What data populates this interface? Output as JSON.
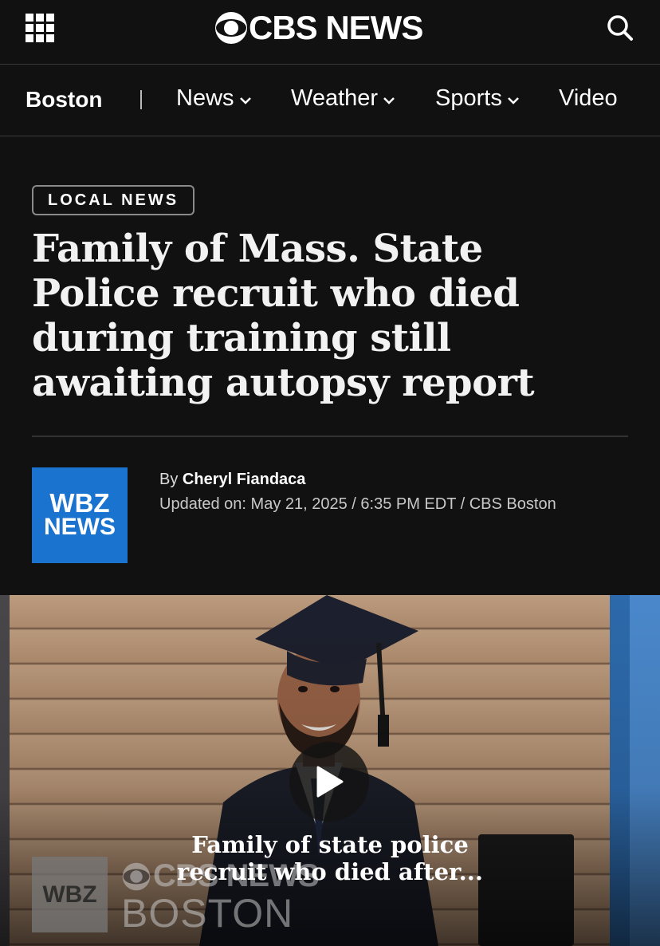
{
  "header": {
    "menu_icon": "grid-menu-icon",
    "logo_text": "CBS NEWS",
    "search_icon": "search-icon"
  },
  "nav": {
    "section": "Boston",
    "items": [
      {
        "label": "News",
        "has_dropdown": true
      },
      {
        "label": "Weather",
        "has_dropdown": true
      },
      {
        "label": "Sports",
        "has_dropdown": true
      },
      {
        "label": "Video",
        "has_dropdown": false
      }
    ]
  },
  "article": {
    "category": "LOCAL NEWS",
    "headline": "Family of Mass. State Police recruit who died during training still awaiting autopsy report",
    "byline_prefix": "By",
    "author": "Cheryl Fiandaca",
    "updated": "Updated on: May 21, 2025 / 6:35 PM EDT / CBS Boston",
    "source_logo": {
      "line1": "WBZ",
      "line2": "NEWS"
    }
  },
  "video": {
    "caption": "Family of state police recruit who died after...",
    "watermark": {
      "box": "WBZ",
      "brand": "CBS NEWS",
      "city": "BOSTON"
    }
  },
  "colors": {
    "background": "#111111",
    "wbz_blue": "#1a73cf"
  }
}
